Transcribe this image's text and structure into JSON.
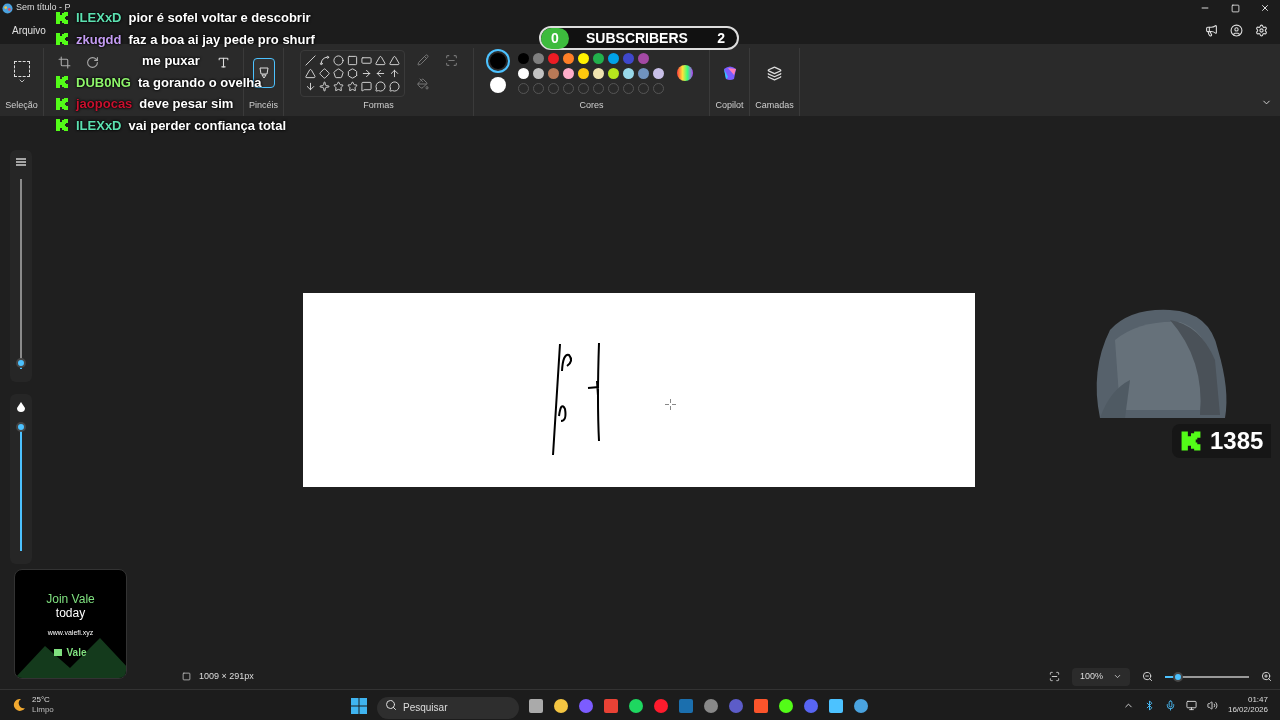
{
  "window": {
    "title": "Sem título - P"
  },
  "menu": [
    "Arquivo"
  ],
  "ribbon": {
    "groups": [
      "Seleção",
      "Pincéis",
      "Formas",
      "Cores",
      "Copilot",
      "Camadas"
    ]
  },
  "current_colors": [
    {
      "color": "#000000",
      "selected": true
    },
    {
      "color": "#ffffff",
      "selected": false
    }
  ],
  "palette": [
    {
      "color": "#000000"
    },
    {
      "color": "#7f7f7f"
    },
    {
      "color": "#ed1c24"
    },
    {
      "color": "#ff7f27"
    },
    {
      "color": "#fff200"
    },
    {
      "color": "#22b14c"
    },
    {
      "color": "#00a2e8"
    },
    {
      "color": "#3f48cc"
    },
    {
      "color": "#a349a4"
    },
    {
      "color": "#ffffff"
    },
    {
      "color": "#c3c3c3"
    },
    {
      "color": "#b97a57"
    },
    {
      "color": "#ffaec9"
    },
    {
      "color": "#ffc90e"
    },
    {
      "color": "#efe4b0"
    },
    {
      "color": "#b5e61d"
    },
    {
      "color": "#99d9ea"
    },
    {
      "color": "#7092be"
    },
    {
      "color": "#c8bfe7"
    }
  ],
  "side_sliders": [
    {
      "kind": "size",
      "level": 0.03
    },
    {
      "kind": "opacity",
      "level": 1
    }
  ],
  "status_bar": {
    "dimensions": "1009 × 291px",
    "zoom": "100%",
    "zoom_level": {
      "level": 0.15
    }
  },
  "chat": [
    {
      "kind": "message",
      "user": "ILEXxD",
      "color": "#5ce0b0",
      "text": "pior é sofel voltar e descobrir"
    },
    {
      "kind": "message",
      "user": "zkugdd",
      "color": "#c49cf2",
      "text": "faz a boa ai jay pede pro shurf"
    },
    {
      "kind": "continuation",
      "text": "me puxar"
    },
    {
      "kind": "message",
      "user": "DUB0NG",
      "color": "#8ef56b",
      "text": "ta gorando o ovelha"
    },
    {
      "kind": "message",
      "user": "jaopocas",
      "color": "#c8102e",
      "text": "deve pesar sim"
    },
    {
      "kind": "message",
      "user": "ILEXxD",
      "color": "#5ce0b0",
      "text": "vai perder confiança total"
    }
  ],
  "subscribers": {
    "current": "0",
    "label": "SUBSCRIBERS",
    "goal": "2"
  },
  "viewer_count": "1385",
  "ad": {
    "headline": "Join Vale",
    "subline": "today",
    "url": "www.valefi.xyz",
    "brand": "Vale"
  },
  "taskbar": {
    "temperature": "25°C",
    "weather": "Limpo",
    "search_placeholder": "Pesquisar",
    "time": "01:47",
    "date": "16/02/2026"
  }
}
